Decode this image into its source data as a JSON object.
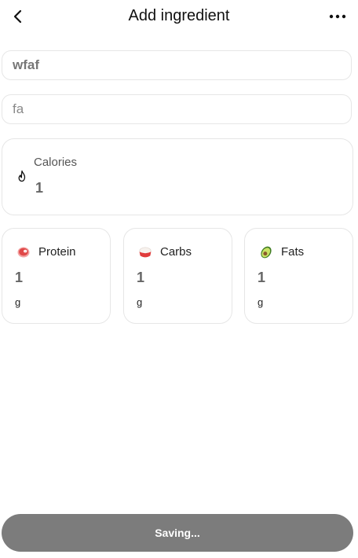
{
  "header": {
    "title": "Add ingredient",
    "back_icon": "chevron-left-icon",
    "more_icon": "more-horizontal-icon"
  },
  "form": {
    "name_value": "wfaf",
    "brand_value": "fa"
  },
  "calories": {
    "label": "Calories",
    "value": "1",
    "icon": "flame-icon"
  },
  "macros": [
    {
      "label": "Protein",
      "value": "1",
      "unit": "g",
      "icon": "meat-icon"
    },
    {
      "label": "Carbs",
      "value": "1",
      "unit": "g",
      "icon": "rice-bowl-icon"
    },
    {
      "label": "Fats",
      "value": "1",
      "unit": "g",
      "icon": "avocado-icon"
    }
  ],
  "footer": {
    "save_label": "Saving..."
  },
  "colors": {
    "button_bg": "#7c7c7c",
    "border": "#e6e6e6",
    "protein_accent": "#e04848",
    "carbs_accent": "#e03c3c",
    "fats_accent": "#6cae3a"
  }
}
